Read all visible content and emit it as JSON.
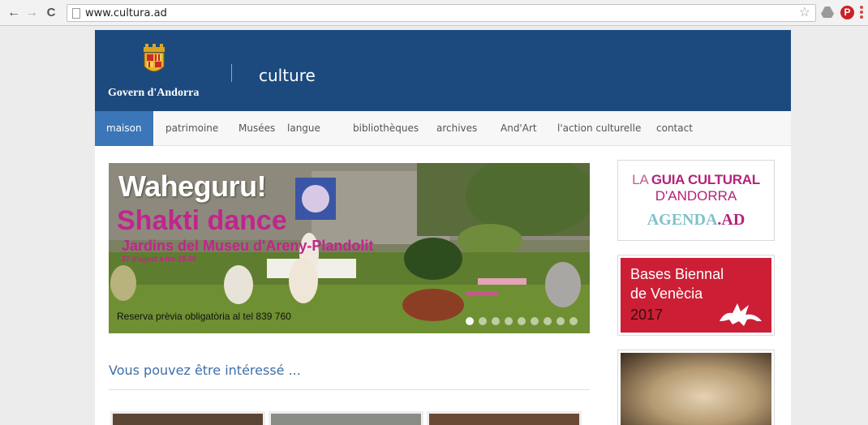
{
  "browser": {
    "url": "www.cultura.ad",
    "back_icon": "arrow-left-icon",
    "forward_icon": "arrow-right-icon",
    "reload_icon": "reload-icon",
    "star_icon": "star-icon"
  },
  "header": {
    "logo_text": "Govern d'Andorra",
    "section_title": "culture",
    "background_color": "#1c4a7e"
  },
  "menu": {
    "items": [
      {
        "label": "maison",
        "active": true
      },
      {
        "label": "patrimoine"
      },
      {
        "label": "Musées"
      },
      {
        "label": "langue"
      },
      {
        "label": "bibliothèques"
      },
      {
        "label": "archives"
      },
      {
        "label": "And'Art"
      },
      {
        "label": "l'action culturelle"
      },
      {
        "label": "contact"
      }
    ]
  },
  "slider": {
    "headline": "Waheguru!",
    "subtitle": "Shakti dance",
    "location": "Jardins del Museu d'Areny-Plandolit",
    "date": "27 d'agost a les 19.30",
    "reservation": "Reserva prèvia obligatòria al tel 839 760",
    "slide_count": 9,
    "active_slide": 1
  },
  "interest": {
    "title": "Vous pouvez être intéressé ..."
  },
  "sidebar": {
    "guia": {
      "line1_a": "LA ",
      "line1_b": "GUIA CULTURAL",
      "line2": "D'ANDORRA",
      "agenda_a": "AGENDA",
      "agenda_b": ".AD"
    },
    "biennal": {
      "line1": "Bases Biennal",
      "line2": "de Venècia",
      "year": "2017"
    }
  }
}
